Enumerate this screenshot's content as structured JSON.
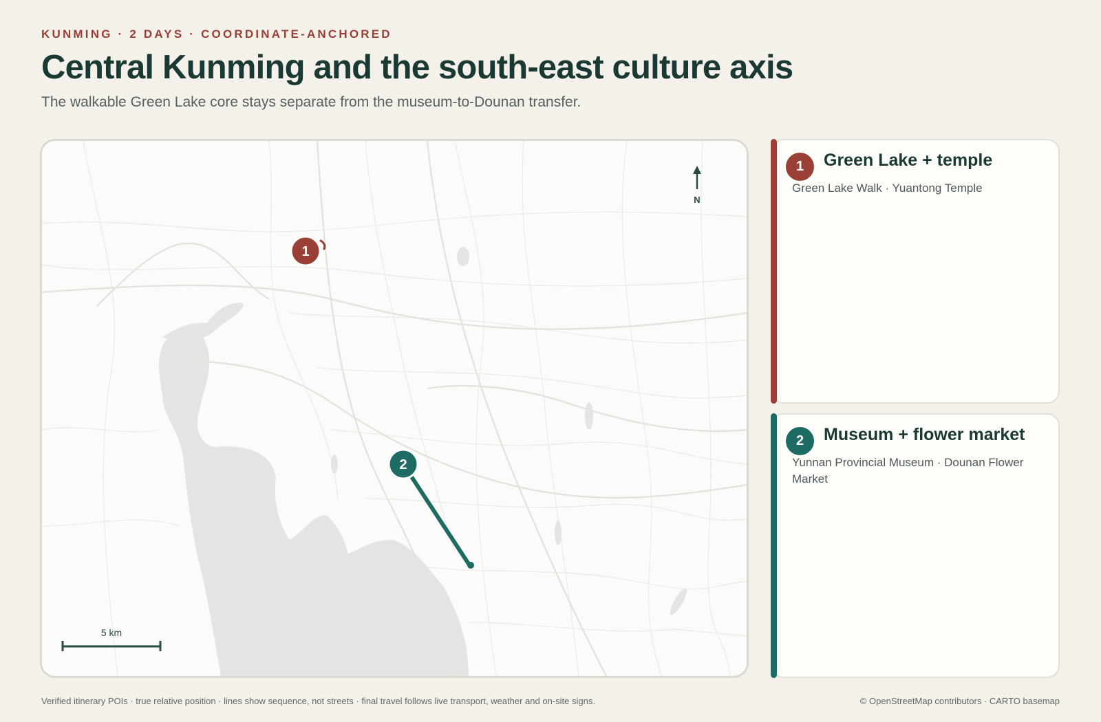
{
  "header": {
    "kicker": "KUNMING · 2 DAYS · COORDINATE-ANCHORED",
    "title": "Central Kunming and the south-east culture axis",
    "subtitle": "The walkable Green Lake core stays separate from the museum-to-Dounan transfer."
  },
  "map": {
    "north_label": "N",
    "scale_label": "5 km",
    "markers": [
      {
        "number": "1",
        "color": "#9a3f35"
      },
      {
        "number": "2",
        "color": "#1e6b63"
      }
    ]
  },
  "days": [
    {
      "number": "1",
      "title": "Green Lake + temple",
      "places": "Green Lake Walk · Yuantong Temple",
      "color": "#9a3f35"
    },
    {
      "number": "2",
      "title": "Museum + flower market",
      "places": "Yunnan Provincial Museum · Dounan Flower Market",
      "color": "#1e6b63"
    }
  ],
  "footer": {
    "note": "Verified itinerary POIs · true relative position · lines show sequence, not streets · final travel follows live transport, weather and on-site signs.",
    "attribution": "© OpenStreetMap contributors · CARTO basemap"
  }
}
